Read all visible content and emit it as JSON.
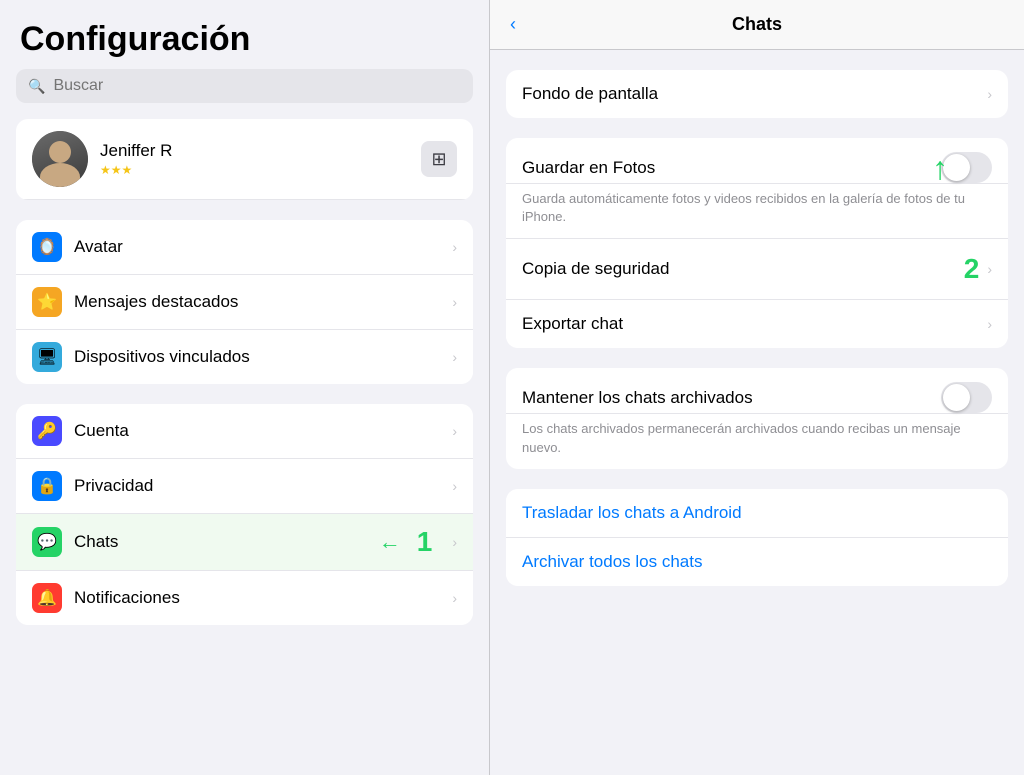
{
  "left": {
    "title": "Configuración",
    "search_placeholder": "Buscar",
    "profile": {
      "name": "Jeniffer R",
      "stars": "★★★"
    },
    "menu_items": [
      {
        "id": "avatar",
        "label": "Avatar",
        "icon_bg": "#007aff",
        "icon": "🪞"
      },
      {
        "id": "mensajes",
        "label": "Mensajes destacados",
        "icon_bg": "#f5a623",
        "icon": "⭐"
      },
      {
        "id": "dispositivos",
        "label": "Dispositivos vinculados",
        "icon_bg": "#34aadc",
        "icon": "🖥"
      },
      {
        "id": "cuenta",
        "label": "Cuenta",
        "icon_bg": "#4a4aff",
        "icon": "🔑"
      },
      {
        "id": "privacidad",
        "label": "Privacidad",
        "icon_bg": "#007aff",
        "icon": "🔒"
      },
      {
        "id": "chats",
        "label": "Chats",
        "icon_bg": "#25d366",
        "icon": "💬",
        "active": true
      },
      {
        "id": "notificaciones",
        "label": "Notificaciones",
        "icon_bg": "#ff3b30",
        "icon": "🔔"
      }
    ],
    "annotations": {
      "arrow_label": "←",
      "number_label": "1"
    }
  },
  "right": {
    "header": {
      "back_label": "‹",
      "title": "Chats"
    },
    "sections": [
      {
        "id": "section1",
        "items": [
          {
            "id": "fondo",
            "label": "Fondo de pantalla",
            "type": "chevron"
          }
        ]
      },
      {
        "id": "section2",
        "items": [
          {
            "id": "guardar_fotos",
            "label": "Guardar en Fotos",
            "type": "toggle",
            "enabled": false,
            "sub_text": "Guarda automáticamente fotos y videos recibidos en la galería de fotos de tu iPhone."
          },
          {
            "id": "copia",
            "label": "Copia de seguridad",
            "type": "chevron"
          },
          {
            "id": "exportar",
            "label": "Exportar chat",
            "type": "chevron"
          }
        ]
      },
      {
        "id": "section3",
        "items": [
          {
            "id": "mantener",
            "label": "Mantener los chats archivados",
            "type": "toggle",
            "enabled": false,
            "sub_text": "Los chats archivados permanecerán archivados cuando recibas un mensaje nuevo."
          }
        ]
      },
      {
        "id": "section4",
        "items": [
          {
            "id": "trasladar",
            "label": "Trasladar los chats a Android",
            "type": "link"
          },
          {
            "id": "archivar",
            "label": "Archivar todos los chats",
            "type": "link"
          }
        ]
      }
    ],
    "annotations": {
      "arrow_label": "↑",
      "number_label": "2"
    }
  }
}
